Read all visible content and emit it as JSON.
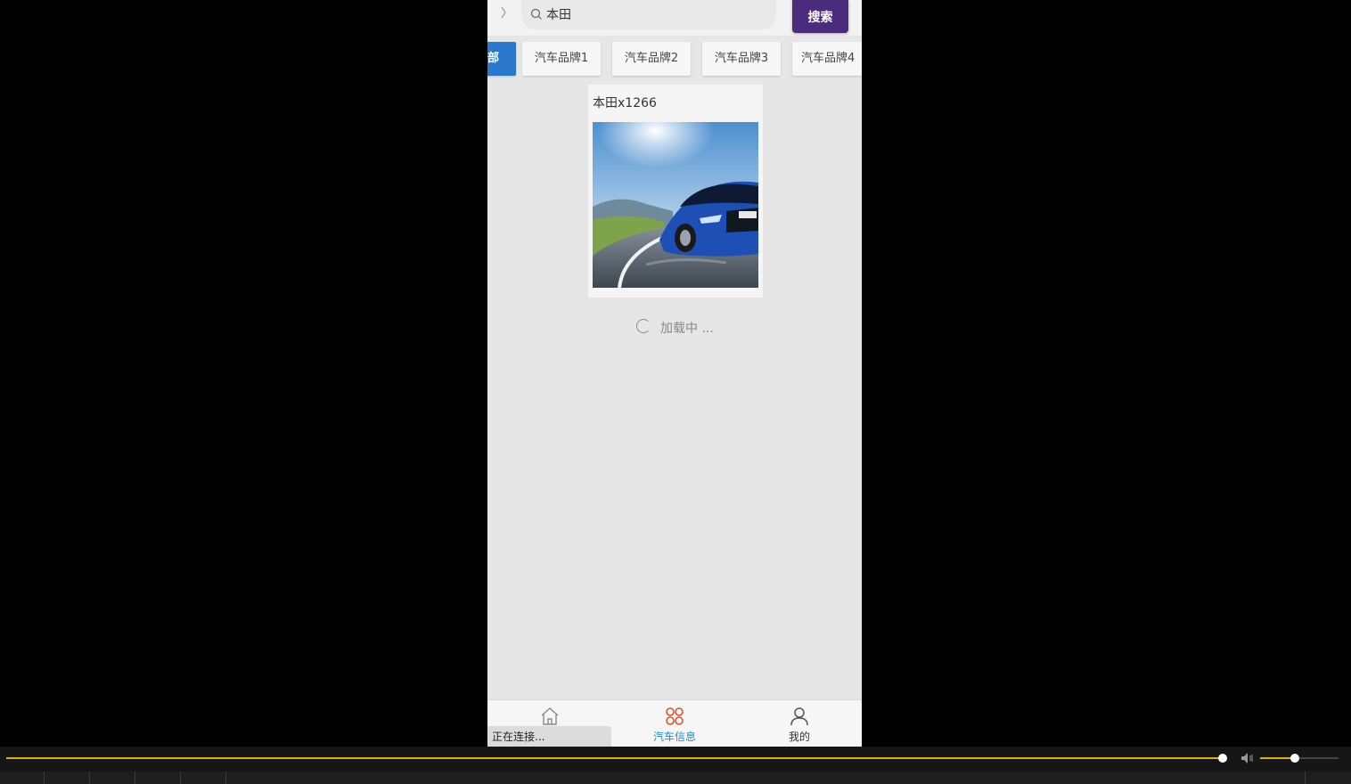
{
  "search": {
    "query": "本田",
    "button_label": "搜索"
  },
  "tabs": [
    {
      "label": "部",
      "active": true
    },
    {
      "label": "汽车品牌1",
      "active": false
    },
    {
      "label": "汽车品牌2",
      "active": false
    },
    {
      "label": "汽车品牌3",
      "active": false
    },
    {
      "label": "汽车品牌4",
      "active": false
    }
  ],
  "results": [
    {
      "title": "本田x1266",
      "image": "blue-car-photo"
    }
  ],
  "loading_text": "加载中 ...",
  "tabbar": {
    "items": [
      {
        "label": "",
        "icon": "home-icon"
      },
      {
        "label": "汽车信息",
        "icon": "grid-icon",
        "active": true
      },
      {
        "label": "我的",
        "icon": "user-icon"
      }
    ],
    "status_toast": "正在连接..."
  },
  "player": {
    "progress": 0.9,
    "volume": 0.4
  },
  "colors": {
    "accent_purple": "#4a2b7c",
    "active_tab": "#2a78cc",
    "tabbar_active": "#1e8bd8",
    "grid_icon": "#e0502a",
    "seek": "#d9b400"
  }
}
